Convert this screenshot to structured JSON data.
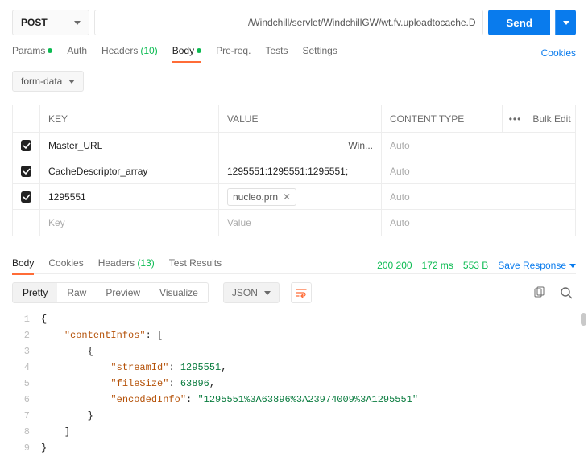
{
  "request": {
    "method": "POST",
    "url": "/Windchill/servlet/WindchillGW/wt.fv.uploadtocache.D",
    "send_label": "Send"
  },
  "reqTabs": {
    "params": "Params",
    "auth": "Auth",
    "headers": "Headers",
    "headers_count": "(10)",
    "body": "Body",
    "prereq": "Pre-req.",
    "tests": "Tests",
    "settings": "Settings",
    "cookies": "Cookies"
  },
  "bodyType": "form-data",
  "grid": {
    "hdr_key": "KEY",
    "hdr_value": "VALUE",
    "hdr_content_type": "CONTENT TYPE",
    "bulk_edit": "Bulk Edit",
    "rows": [
      {
        "key": "Master_URL",
        "value_trunc": "Win...",
        "ct": "Auto"
      },
      {
        "key": "CacheDescriptor_array",
        "value": "1295551:1295551:1295551;",
        "ct": "Auto"
      },
      {
        "key": "1295551",
        "file": "nucleo.prn",
        "ct": "Auto"
      }
    ],
    "placeholder_key": "Key",
    "placeholder_value": "Value",
    "placeholder_ct": "Auto"
  },
  "respTabs": {
    "body": "Body",
    "cookies": "Cookies",
    "headers": "Headers",
    "headers_count": "(13)",
    "tests": "Test Results"
  },
  "respMeta": {
    "status_code_raw": "200",
    "status_code": "200",
    "time": "172 ms",
    "size": "553 B",
    "save": "Save Response"
  },
  "viewer": {
    "pretty": "Pretty",
    "raw": "Raw",
    "preview": "Preview",
    "visualize": "Visualize",
    "format": "JSON"
  },
  "json": {
    "l1": "{",
    "l2_k": "\"contentInfos\"",
    "l2_r": ": [",
    "l3": "{",
    "l4_k": "\"streamId\"",
    "l4_v": "1295551",
    "l5_k": "\"fileSize\"",
    "l5_v": "63896",
    "l6_k": "\"encodedInfo\"",
    "l6_v": "\"1295551%3A63896%3A23974009%3A1295551\"",
    "l7": "}",
    "l8": "]",
    "l9": "}"
  }
}
